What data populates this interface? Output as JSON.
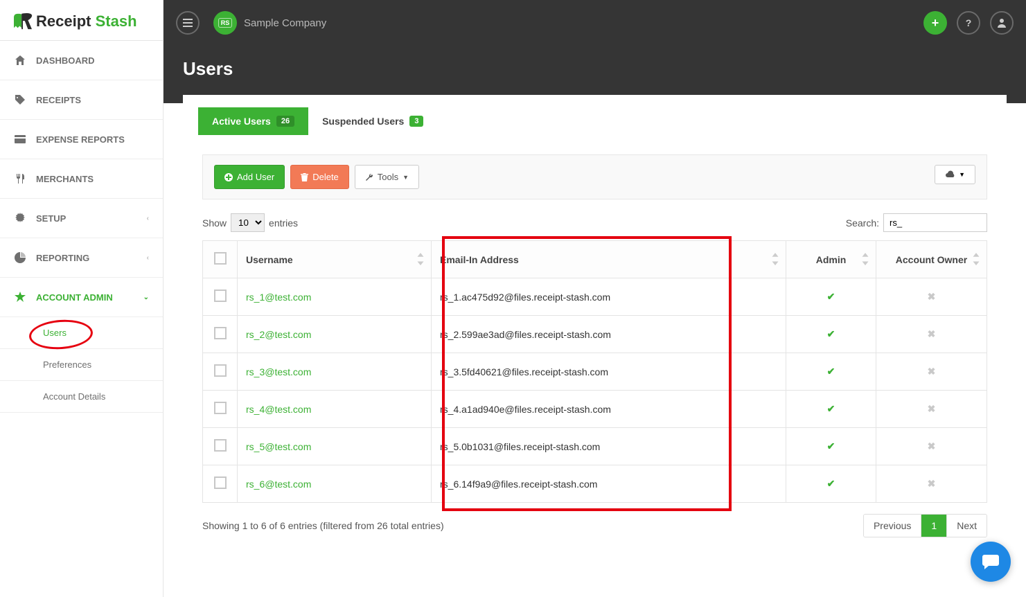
{
  "brand": {
    "receipt": "Receipt",
    "stash": "Stash"
  },
  "topbar": {
    "company": "Sample Company"
  },
  "sidebar": {
    "dashboard": "DASHBOARD",
    "receipts": "RECEIPTS",
    "expense_reports": "EXPENSE REPORTS",
    "merchants": "MERCHANTS",
    "setup": "SETUP",
    "reporting": "REPORTING",
    "account_admin": "ACCOUNT ADMIN",
    "users": "Users",
    "preferences": "Preferences",
    "account_details": "Account Details"
  },
  "page": {
    "title": "Users"
  },
  "tabs": {
    "active_label": "Active Users",
    "active_count": "26",
    "suspended_label": "Suspended Users",
    "suspended_count": "3"
  },
  "toolbar": {
    "add_user": "Add User",
    "delete": "Delete",
    "tools": "Tools"
  },
  "table": {
    "show_label": "Show",
    "entries_label": "entries",
    "show_value": "10",
    "search_label": "Search:",
    "search_value": "rs_",
    "headers": {
      "username": "Username",
      "email_in": "Email-In Address",
      "admin": "Admin",
      "account_owner": "Account Owner"
    },
    "rows": [
      {
        "username": "rs_1@test.com",
        "email_in": "rs_1.ac475d92@files.receipt-stash.com",
        "admin": true,
        "owner": false
      },
      {
        "username": "rs_2@test.com",
        "email_in": "rs_2.599ae3ad@files.receipt-stash.com",
        "admin": true,
        "owner": false
      },
      {
        "username": "rs_3@test.com",
        "email_in": "rs_3.5fd40621@files.receipt-stash.com",
        "admin": true,
        "owner": false
      },
      {
        "username": "rs_4@test.com",
        "email_in": "rs_4.a1ad940e@files.receipt-stash.com",
        "admin": true,
        "owner": false
      },
      {
        "username": "rs_5@test.com",
        "email_in": "rs_5.0b1031@files.receipt-stash.com",
        "admin": true,
        "owner": false
      },
      {
        "username": "rs_6@test.com",
        "email_in": "rs_6.14f9a9@files.receipt-stash.com",
        "admin": true,
        "owner": false
      }
    ],
    "footer": "Showing 1 to 6 of 6 entries (filtered from 26 total entries)"
  },
  "pagination": {
    "previous": "Previous",
    "page1": "1",
    "next": "Next"
  }
}
